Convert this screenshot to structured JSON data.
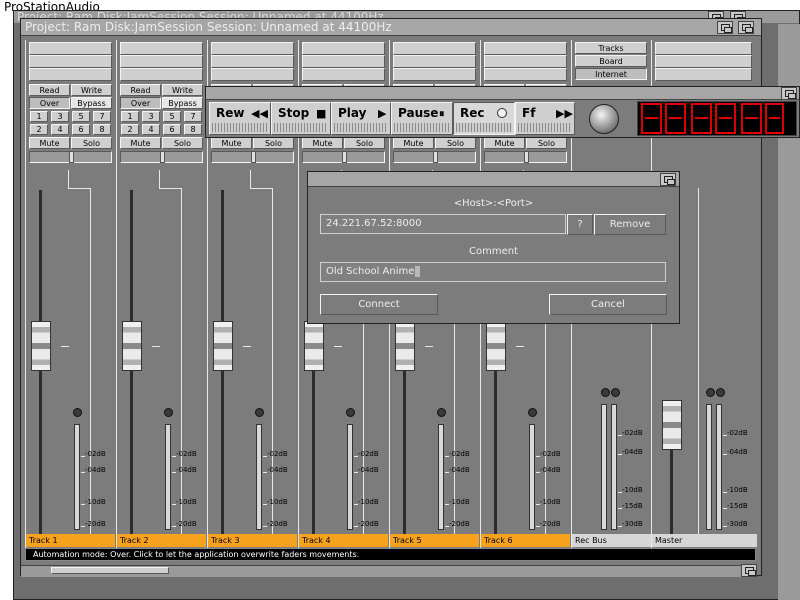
{
  "outer_title": "ProStationAudio",
  "back_title": "Project: Ram Disk:JamSession Session: Unnamed at 44100Hz",
  "window_title": "Project: Ram Disk:JamSession Session: Unnamed at 44100Hz",
  "strip_buttons": {
    "read": "Read",
    "write": "Write",
    "over": "Over",
    "bypass": "Bypass",
    "numbers": [
      "1",
      "3",
      "5",
      "7",
      "2",
      "4",
      "6",
      "8"
    ],
    "mute": "Mute",
    "solo": "Solo"
  },
  "view_buttons": [
    "Tracks",
    "Board",
    "Internet"
  ],
  "tracks": [
    "Track 1",
    "Track 2",
    "Track 3",
    "Track 4",
    "Track 5",
    "Track 6"
  ],
  "rec_bus_label": "Rec Bus",
  "master_label": "Master",
  "db_scale": [
    "-02dB",
    "-04dB",
    "-10dB",
    "-20dB"
  ],
  "db_scale_bus": [
    "-02dB",
    "-04dB",
    "-10dB",
    "-15dB",
    "-30dB"
  ],
  "transport": {
    "rew": "Rew",
    "stop": "Stop",
    "play": "Play",
    "pause": "Pause",
    "rec": "Rec",
    "ff": "Ff"
  },
  "status_bar": "Automation mode: Over. Click to let the application overwrite faders movements.",
  "dialog": {
    "host_label": "<Host>:<Port>",
    "host_value": "24.221.67.52:8000",
    "help_label": "?",
    "remove_label": "Remove",
    "comment_label": "Comment",
    "comment_value": "Old School Anime",
    "connect_label": "Connect",
    "cancel_label": "Cancel"
  },
  "colors": {
    "track_label_bg": "#f7a21c",
    "panel_gray": "#7c7c7c",
    "led_red": "#e00000",
    "status_bg": "#000000"
  }
}
